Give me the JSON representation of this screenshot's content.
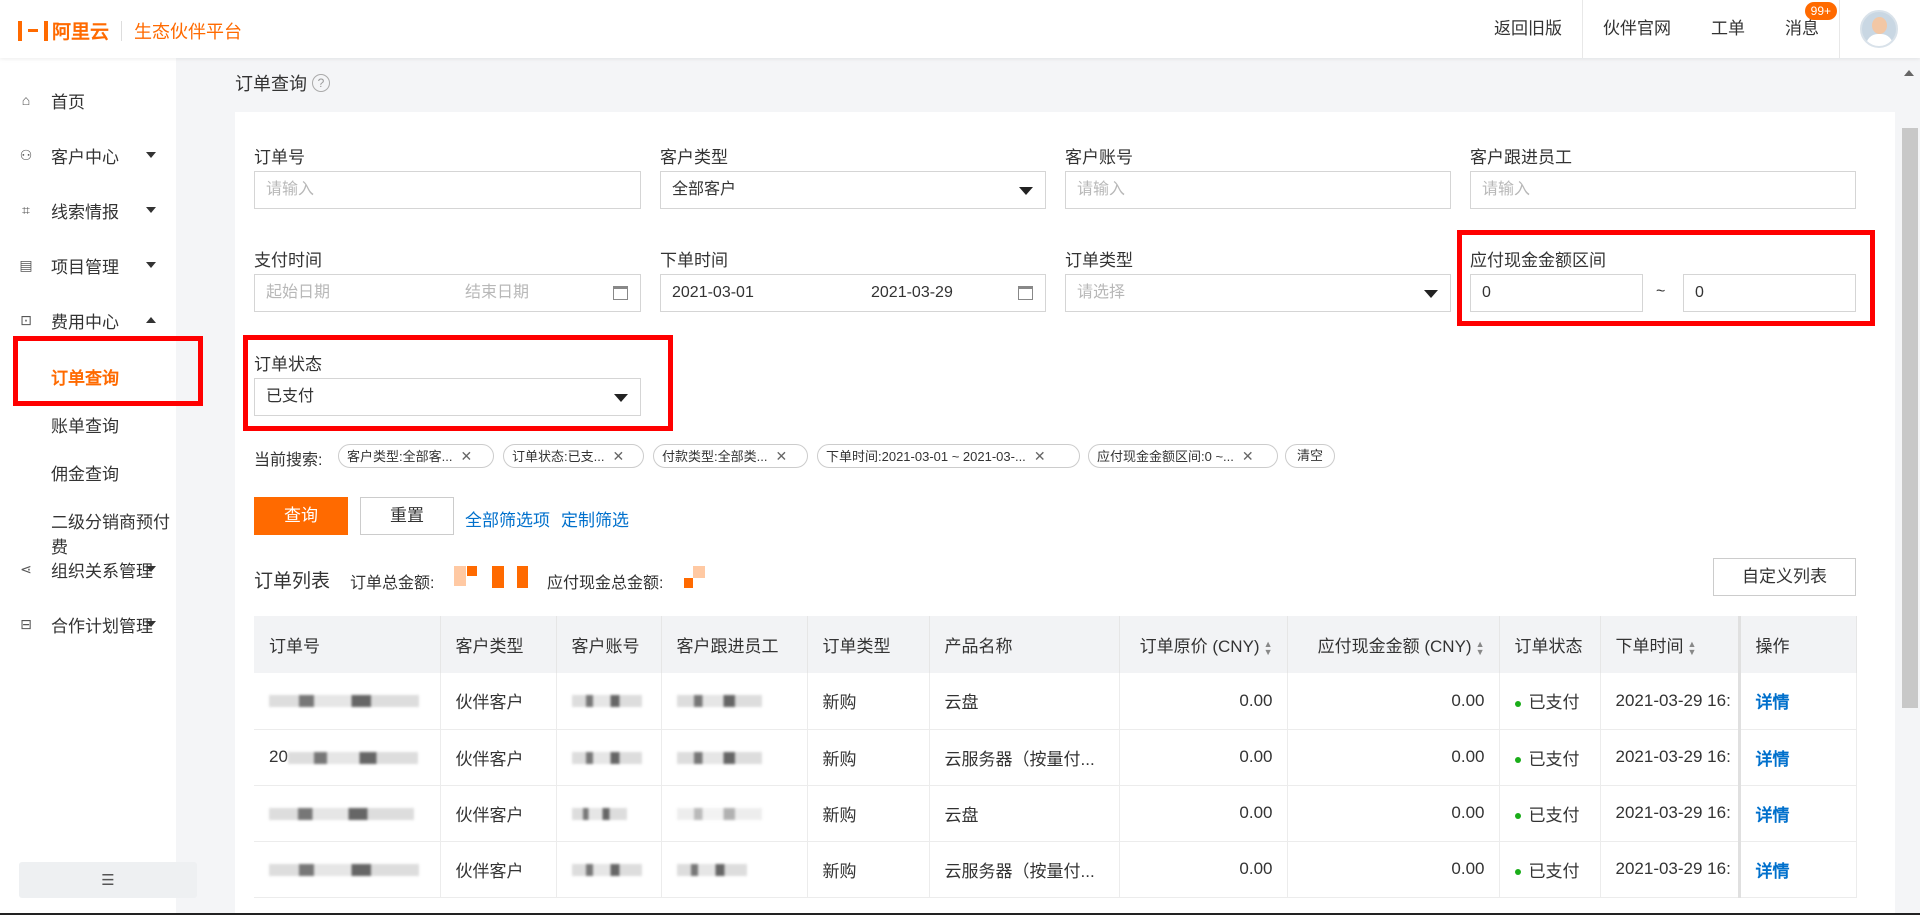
{
  "header": {
    "brand": "阿里云",
    "brand_sub": "生态伙伴平台",
    "nav": [
      "返回旧版",
      "伙伴官网",
      "工单",
      "消息"
    ],
    "badge": "99+",
    "colors": {
      "accent": "#ff6a00",
      "link": "#0070cc"
    }
  },
  "sidebar": {
    "items": [
      {
        "label": "首页",
        "icon": "home-icon"
      },
      {
        "label": "客户中心",
        "icon": "customer-icon"
      },
      {
        "label": "线索情报",
        "icon": "lead-icon"
      },
      {
        "label": "项目管理",
        "icon": "project-icon"
      },
      {
        "label": "费用中心",
        "icon": "billing-icon"
      },
      {
        "label": "组织关系管理",
        "icon": "org-icon"
      },
      {
        "label": "合作计划管理",
        "icon": "plan-icon"
      }
    ],
    "sub_items": [
      "订单查询",
      "账单查询",
      "佣金查询",
      "二级分销商预付费"
    ],
    "collapse_icon": "collapse-menu-icon"
  },
  "page": {
    "title": "订单查询",
    "help": "?"
  },
  "filters": {
    "order_no": {
      "label": "订单号",
      "placeholder": "请输入"
    },
    "customer_type": {
      "label": "客户类型",
      "value": "全部客户"
    },
    "customer_account": {
      "label": "客户账号",
      "placeholder": "请输入"
    },
    "follow_staff": {
      "label": "客户跟进员工",
      "placeholder": "请输入"
    },
    "pay_time": {
      "label": "支付时间",
      "start_placeholder": "起始日期",
      "end_placeholder": "结束日期"
    },
    "order_time": {
      "label": "下单时间",
      "start": "2021-03-01",
      "end": "2021-03-29"
    },
    "order_type": {
      "label": "订单类型",
      "placeholder": "请选择"
    },
    "amount_range": {
      "label": "应付现金金额区间",
      "min": "0",
      "max": "0",
      "sep": "~"
    },
    "order_status": {
      "label": "订单状态",
      "value": "已支付"
    }
  },
  "current_search": {
    "label": "当前搜索:",
    "tags": [
      "客户类型:全部客...",
      "订单状态:已支...",
      "付款类型:全部类...",
      "下单时间:2021-03-01 ~ 2021-03-...",
      "应付现金金额区间:0 ~..."
    ],
    "clear": "清空"
  },
  "actions": {
    "search": "查询",
    "reset": "重置",
    "all_filters": "全部筛选项",
    "custom_filters": "定制筛选"
  },
  "list": {
    "title": "订单列表",
    "total_label": "订单总金额:",
    "cash_total_label": "应付现金总金额:",
    "customize": "自定义列表",
    "columns": [
      "订单号",
      "客户类型",
      "客户账号",
      "客户跟进员工",
      "订单类型",
      "产品名称",
      "订单原价 (CNY)",
      "应付现金金额 (CNY)",
      "订单状态",
      "下单时间",
      "操作"
    ],
    "rows": [
      {
        "order_no": "",
        "customer_type": "伙伴客户",
        "account": "",
        "staff": "",
        "order_type": "新购",
        "product": "云盘",
        "price": "0.00",
        "cash": "0.00",
        "status": "已支付",
        "time": "2021-03-29 16:",
        "op": "详情"
      },
      {
        "order_no": "20",
        "customer_type": "伙伴客户",
        "account": "",
        "staff": "",
        "order_type": "新购",
        "product": "云服务器（按量付...",
        "price": "0.00",
        "cash": "0.00",
        "status": "已支付",
        "time": "2021-03-29 16:",
        "op": "详情"
      },
      {
        "order_no": "",
        "customer_type": "伙伴客户",
        "account": "",
        "staff": "",
        "order_type": "新购",
        "product": "云盘",
        "price": "0.00",
        "cash": "0.00",
        "status": "已支付",
        "time": "2021-03-29 16:",
        "op": "详情"
      },
      {
        "order_no": "",
        "customer_type": "伙伴客户",
        "account": "",
        "staff": "",
        "order_type": "新购",
        "product": "云服务器（按量付...",
        "price": "0.00",
        "cash": "0.00",
        "status": "已支付",
        "time": "2021-03-29 16:",
        "op": "详情"
      }
    ]
  }
}
